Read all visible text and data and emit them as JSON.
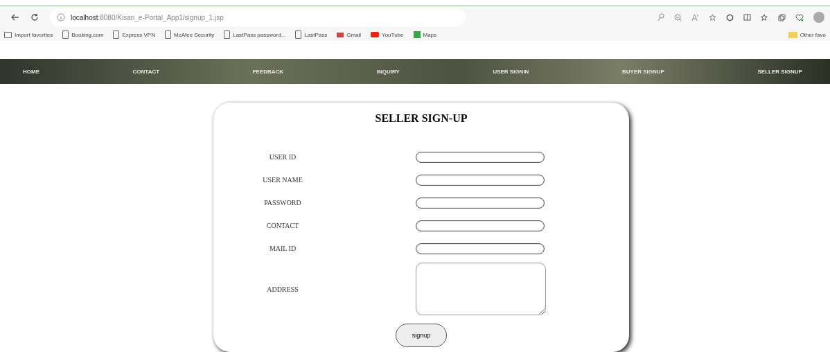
{
  "browser": {
    "url_host": "localhost",
    "url_rest": ":8080/Kisan_e-Portal_App1/signup_1.jsp"
  },
  "bookmarks": [
    {
      "label": "Import favorites",
      "kind": "import"
    },
    {
      "label": "Booking.com",
      "kind": "page"
    },
    {
      "label": "Express VPN",
      "kind": "page"
    },
    {
      "label": "McAfee Security",
      "kind": "page"
    },
    {
      "label": "LastPass password...",
      "kind": "page"
    },
    {
      "label": "LastPass",
      "kind": "page"
    },
    {
      "label": "Gmail",
      "kind": "gmail"
    },
    {
      "label": "YouTube",
      "kind": "youtube"
    },
    {
      "label": "Maps",
      "kind": "maps"
    }
  ],
  "other_favorites": "Other favo",
  "nav": [
    "HOME",
    "CONTACT",
    "FEEDBACK",
    "INQUIRY",
    "USER SIGNIN",
    "BUYER SIGNUP",
    "SELLER SIGNUP"
  ],
  "form": {
    "title": "SELLER SIGN-UP",
    "fields": [
      {
        "label": "USER ID",
        "kind": "input"
      },
      {
        "label": "USER NAME",
        "kind": "input"
      },
      {
        "label": "PASSWORD",
        "kind": "input"
      },
      {
        "label": "CONTACT",
        "kind": "input"
      },
      {
        "label": "MAIL ID",
        "kind": "input"
      },
      {
        "label": "ADDRESS",
        "kind": "textarea"
      }
    ],
    "button": "signup"
  }
}
